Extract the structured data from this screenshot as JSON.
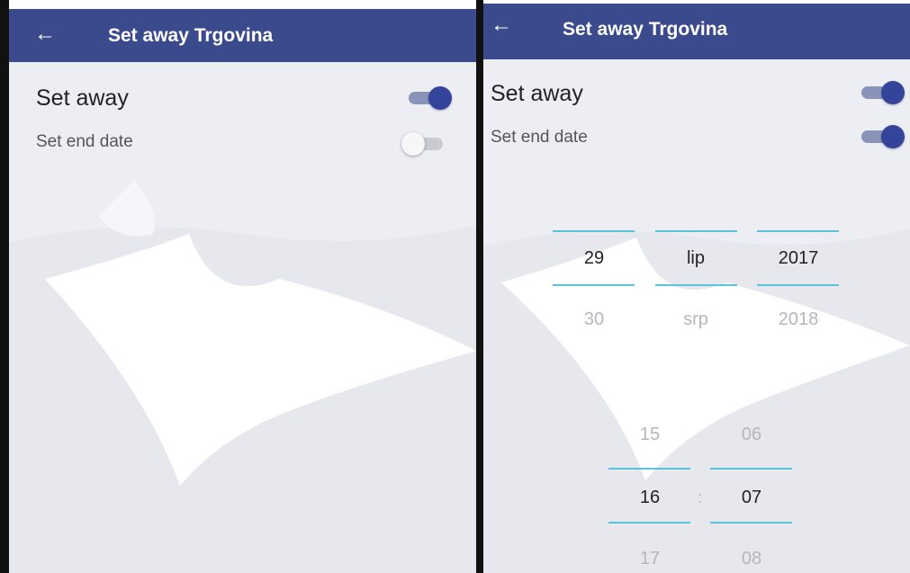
{
  "screens": [
    {
      "title": "Set away Trgovina",
      "back_icon": "arrow-left-icon",
      "set_away_label": "Set away",
      "set_away_on": true,
      "end_date_label": "Set end date",
      "end_date_on": false
    },
    {
      "title": "Set away Trgovina",
      "back_icon": "arrow-left-icon",
      "set_away_label": "Set away",
      "set_away_on": true,
      "end_date_label": "Set end date",
      "end_date_on": true,
      "date_picker": {
        "selected": {
          "day": "29",
          "month": "lip",
          "year": "2017"
        },
        "next": {
          "day": "30",
          "month": "srp",
          "year": "2018"
        }
      },
      "time_picker": {
        "previous": {
          "hour": "15",
          "minute": "06"
        },
        "selected": {
          "hour": "16",
          "minute": "07"
        },
        "separator": ":",
        "next": {
          "hour": "17",
          "minute": "08"
        }
      }
    }
  ],
  "colors": {
    "app_bar": "#3a4a8c",
    "toggle_on": "#33449a",
    "picker_line": "#5cc3d6",
    "background": "#eef0f5"
  }
}
